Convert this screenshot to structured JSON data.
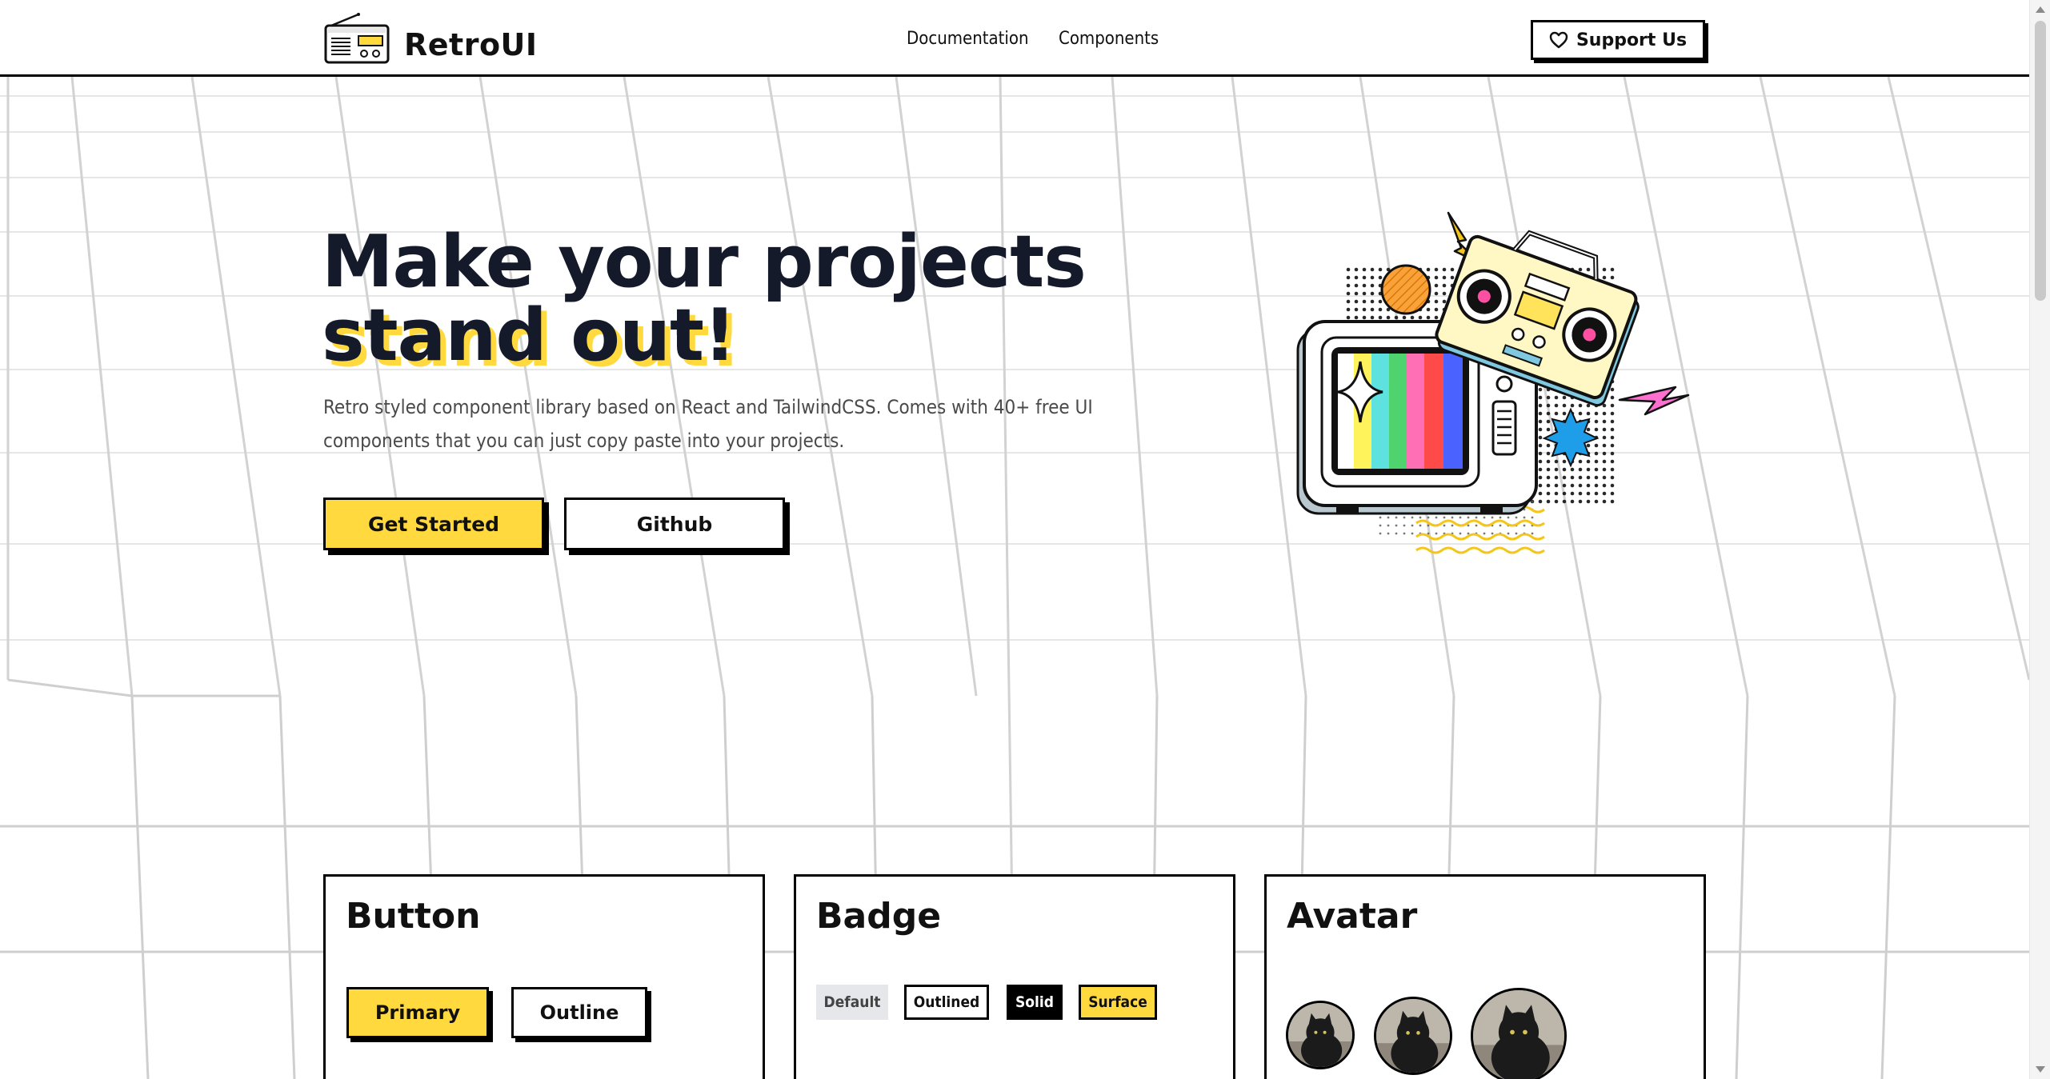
{
  "header": {
    "brand": "RetroUI",
    "nav": [
      {
        "label": "Documentation"
      },
      {
        "label": "Components"
      }
    ],
    "support_label": "Support Us"
  },
  "hero": {
    "title_line1": "Make your projects",
    "title_line2": "stand out!",
    "description": "Retro styled component library based on React and TailwindCSS. Comes with 40+ free UI components that you can just copy paste into your projects.",
    "primary_cta": "Get Started",
    "secondary_cta": "Github"
  },
  "cards": {
    "button": {
      "title": "Button",
      "primary_label": "Primary",
      "outline_label": "Outline"
    },
    "badge": {
      "title": "Badge",
      "labels": [
        "Default",
        "Outlined",
        "Solid",
        "Surface"
      ]
    },
    "avatar": {
      "title": "Avatar"
    }
  },
  "colors": {
    "accent_yellow": "#ffd93d",
    "title_navy": "#151a2a",
    "border_black": "#000000",
    "badge_gray": "#e5e7eb",
    "grid_line": "#cfcfcf"
  },
  "icons": {
    "logo": "radio-icon",
    "support": "heart-icon",
    "hero_art": "retro-tv-boombox-illustration",
    "avatars": "cat-photo"
  }
}
